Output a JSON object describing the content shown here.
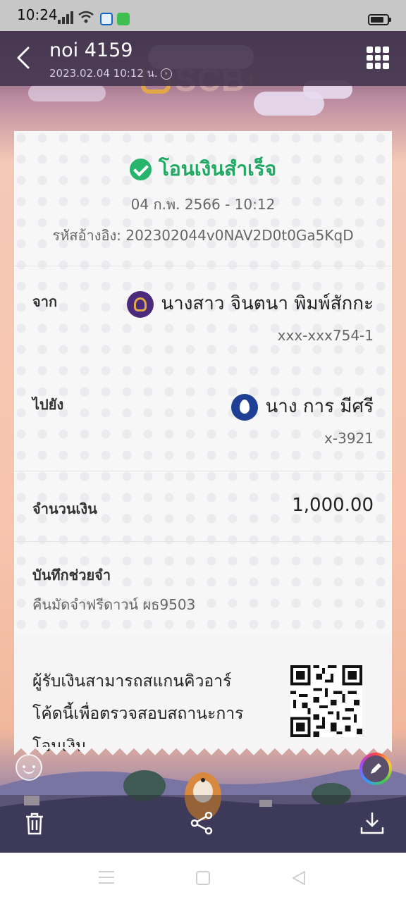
{
  "status_bar": {
    "time": "10:24"
  },
  "header": {
    "chat_name": "noi 4159",
    "chat_date": "2023.02.04 10:12 น."
  },
  "background_logo": {
    "text": "SCB",
    "plus": "+"
  },
  "slip": {
    "status": "โอนเงินสำเร็จ",
    "date_time": "04 ก.พ. 2566 - 10:12",
    "reference": "รหัสอ้างอิง: 202302044v0NAV2D0t0Ga5KqD",
    "from": {
      "label": "จาก",
      "name": "นางสาว จินตนา พิมพ์สักกะ",
      "account": "xxx-xxx754-1",
      "bank_icon": "scb-bank-icon"
    },
    "to": {
      "label": "ไปยัง",
      "name": "นาง การ มีศรี",
      "account": "x-3921",
      "bank_icon": "bangkok-bank-icon"
    },
    "amount": {
      "label": "จำนวนเงิน",
      "value": "1,000.00"
    },
    "memo": {
      "label": "บันทึกช่วยจำ",
      "text": "คืนมัดจำฟรีดาวน์ ผธ9503"
    },
    "qr": {
      "line1": "ผู้รับเงินสามารถสแกนคิวอาร์",
      "line2": "โค้ดนี้เพื่อตรวจสอบสถานะการ",
      "line3": "โอนเงิน"
    }
  },
  "colors": {
    "success_green": "#21a963",
    "header_bg": "#463750",
    "scb_purple": "#4b2a7b",
    "bbl_blue": "#1e3f93"
  }
}
